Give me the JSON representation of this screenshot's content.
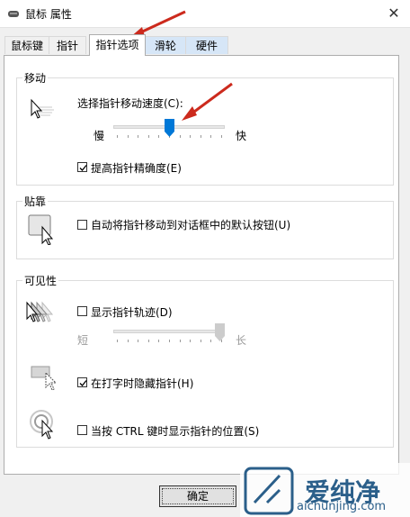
{
  "window": {
    "title": "鼠标 属性",
    "close_glyph": "✕"
  },
  "tabs": [
    {
      "label": "鼠标键"
    },
    {
      "label": "指针"
    },
    {
      "label": "指针选项"
    },
    {
      "label": "滑轮"
    },
    {
      "label": "硬件"
    }
  ],
  "motion": {
    "title": "移动",
    "speed_label": "选择指针移动速度(C):",
    "slow": "慢",
    "fast": "快",
    "speed_value": 0.5,
    "precision_label": "提高指针精确度(E)",
    "precision_checked": true
  },
  "snap": {
    "title": "贴靠",
    "label": "自动将指针移动到对话框中的默认按钮(U)",
    "checked": false
  },
  "visibility": {
    "title": "可见性",
    "trails_label": "显示指针轨迹(D)",
    "trails_checked": false,
    "short": "短",
    "long": "长",
    "trails_value": 1.0,
    "hide_label": "在打字时隐藏指针(H)",
    "hide_checked": true,
    "ctrl_label": "当按 CTRL 键时显示指针的位置(S)",
    "ctrl_checked": false
  },
  "ok_button": {
    "label": "确定"
  },
  "watermark": {
    "text": "爱纯净",
    "url": "aichunjing.com"
  },
  "colors": {
    "accent": "#0078d7",
    "arrow": "#cc2a1d",
    "watermark": "#2b5f8a"
  }
}
